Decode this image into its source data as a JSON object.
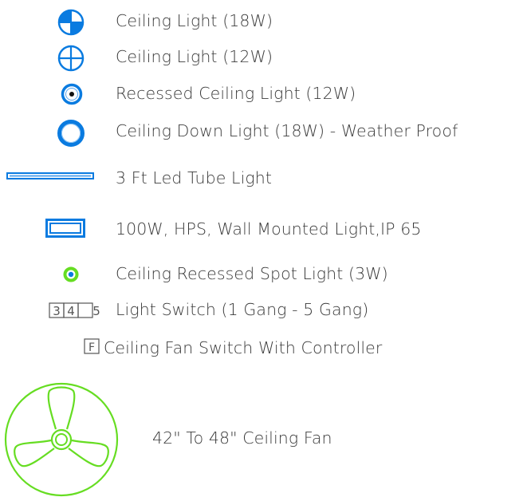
{
  "legend": {
    "items": [
      {
        "id": "ceiling-light-18w",
        "icon": "ceiling-light-18w-icon",
        "label": "Ceiling Light (18W)"
      },
      {
        "id": "ceiling-light-12w",
        "icon": "ceiling-light-12w-icon",
        "label": "Ceiling Light (12W)"
      },
      {
        "id": "recessed-ceiling-light-12w",
        "icon": "recessed-ceiling-light-icon",
        "label": "Recessed Ceiling Light (12W)"
      },
      {
        "id": "ceiling-down-light-18w",
        "icon": "ceiling-down-light-icon",
        "label": "Ceiling Down Light (18W) - Weather Proof"
      },
      {
        "id": "led-tube-light",
        "icon": "led-tube-light-icon",
        "label": "3 Ft Led Tube Light"
      },
      {
        "id": "hps-wall-light",
        "icon": "hps-wall-light-icon",
        "label": "100W, HPS, Wall Mounted Light,IP 65"
      },
      {
        "id": "recessed-spot-light",
        "icon": "recessed-spot-light-icon",
        "label": "Ceiling Recessed Spot Light (3W)"
      },
      {
        "id": "light-switch",
        "icon": "light-switch-icon",
        "label": "Light Switch (1 Gang - 5 Gang)",
        "switch_glyphs": [
          "3",
          "4",
          "5"
        ]
      },
      {
        "id": "fan-switch",
        "icon": "fan-switch-icon",
        "label": "Ceiling Fan Switch With Controller",
        "switch_glyph": "F"
      },
      {
        "id": "ceiling-fan",
        "icon": "ceiling-fan-icon",
        "label": "42\" To 48\" Ceiling Fan"
      }
    ]
  },
  "colors": {
    "light_blue": "#0a7be0",
    "fan_green": "#66dd22",
    "switch_gray": "#555555",
    "text": "#3a3a3a"
  }
}
